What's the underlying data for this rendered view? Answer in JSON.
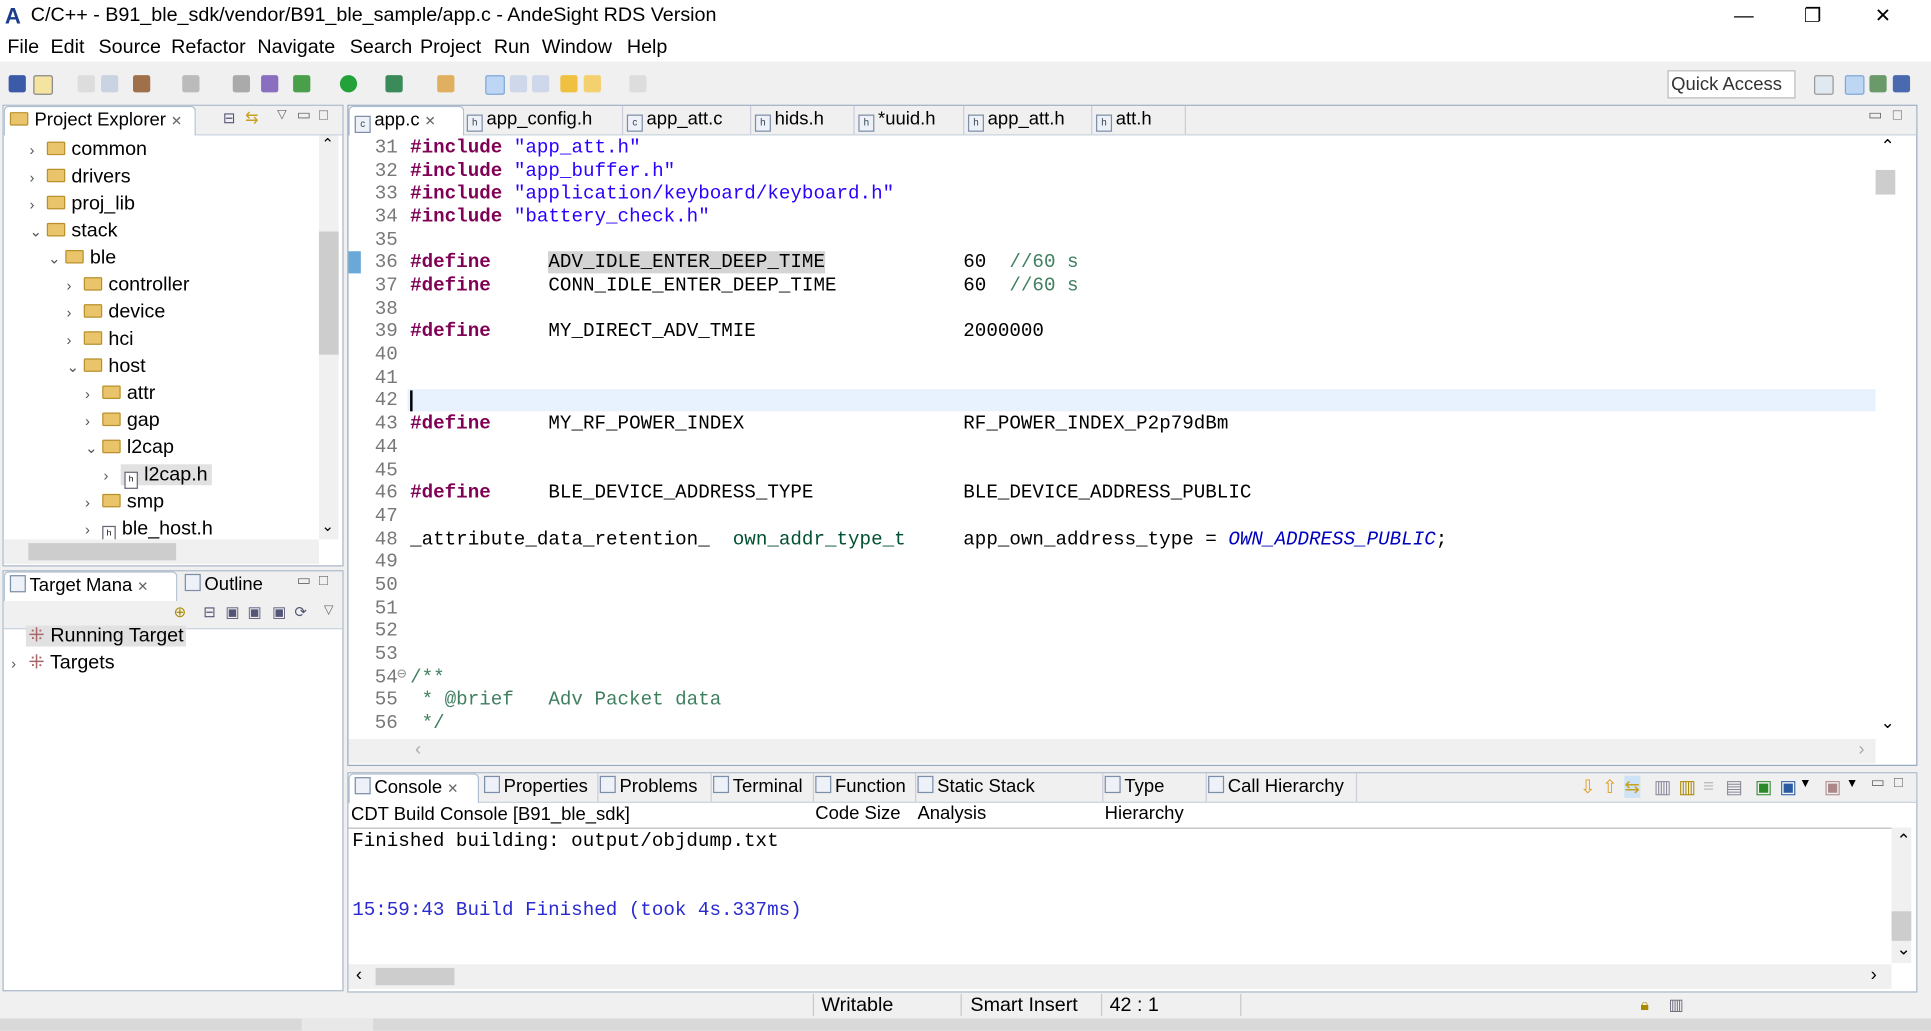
{
  "window": {
    "title": "C/C++ - B91_ble_sdk/vendor/B91_ble_sample/app.c - AndeSight RDS Version",
    "minimize": "—",
    "restore": "❐",
    "close": "✕"
  },
  "menu": [
    "File",
    "Edit",
    "Source",
    "Refactor",
    "Navigate",
    "Search",
    "Project",
    "Run",
    "Window",
    "Help"
  ],
  "toolbar": {
    "quick_access": "Quick Access"
  },
  "project_explorer": {
    "title": "Project Explorer",
    "items": [
      {
        "label": "common",
        "depth": 1,
        "state": "collapsed",
        "kind": "folder"
      },
      {
        "label": "drivers",
        "depth": 1,
        "state": "collapsed",
        "kind": "folder"
      },
      {
        "label": "proj_lib",
        "depth": 1,
        "state": "collapsed",
        "kind": "folder"
      },
      {
        "label": "stack",
        "depth": 1,
        "state": "expanded",
        "kind": "folder"
      },
      {
        "label": "ble",
        "depth": 2,
        "state": "expanded",
        "kind": "folder"
      },
      {
        "label": "controller",
        "depth": 3,
        "state": "collapsed",
        "kind": "folder"
      },
      {
        "label": "device",
        "depth": 3,
        "state": "collapsed",
        "kind": "folder"
      },
      {
        "label": "hci",
        "depth": 3,
        "state": "collapsed",
        "kind": "folder"
      },
      {
        "label": "host",
        "depth": 3,
        "state": "expanded",
        "kind": "folder"
      },
      {
        "label": "attr",
        "depth": 4,
        "state": "collapsed",
        "kind": "folder"
      },
      {
        "label": "gap",
        "depth": 4,
        "state": "collapsed",
        "kind": "folder"
      },
      {
        "label": "l2cap",
        "depth": 4,
        "state": "expanded",
        "kind": "folder"
      },
      {
        "label": "l2cap.h",
        "depth": 5,
        "state": "collapsed",
        "kind": "file",
        "selected": true
      },
      {
        "label": "smp",
        "depth": 4,
        "state": "collapsed",
        "kind": "folder"
      },
      {
        "label": "ble_host.h",
        "depth": 4,
        "state": "collapsed",
        "kind": "file"
      }
    ]
  },
  "target_manager": {
    "tabs": [
      "Target Mana",
      "Outline"
    ],
    "items": [
      {
        "label": "Running Target",
        "selected": true
      },
      {
        "label": "Targets"
      }
    ]
  },
  "editor": {
    "tabs": [
      {
        "label": "app.c",
        "active": true
      },
      {
        "label": "app_config.h"
      },
      {
        "label": "app_att.c"
      },
      {
        "label": "hids.h"
      },
      {
        "label": "*uuid.h"
      },
      {
        "label": "app_att.h"
      },
      {
        "label": "att.h"
      }
    ],
    "lines": [
      {
        "n": "31",
        "tokens": [
          [
            "kw",
            "#include"
          ],
          [
            "",
            " "
          ],
          [
            "str",
            "\"app_att.h\""
          ]
        ]
      },
      {
        "n": "32",
        "tokens": [
          [
            "kw",
            "#include"
          ],
          [
            "",
            " "
          ],
          [
            "str",
            "\"app_buffer.h\""
          ]
        ]
      },
      {
        "n": "33",
        "tokens": [
          [
            "kw",
            "#include"
          ],
          [
            "",
            " "
          ],
          [
            "str",
            "\"application/keyboard/keyboard.h\""
          ]
        ]
      },
      {
        "n": "34",
        "tokens": [
          [
            "kw",
            "#include"
          ],
          [
            "",
            " "
          ],
          [
            "str",
            "\"battery_check.h\""
          ]
        ]
      },
      {
        "n": "35",
        "tokens": []
      },
      {
        "n": "36",
        "tokens": [
          [
            "kw",
            "#define"
          ],
          [
            "",
            "     "
          ],
          [
            "hl",
            "ADV_IDLE_ENTER_DEEP_TIME"
          ],
          [
            "",
            "            60  "
          ],
          [
            "cm",
            "//60 s"
          ]
        ]
      },
      {
        "n": "37",
        "tokens": [
          [
            "kw",
            "#define"
          ],
          [
            "",
            "     "
          ],
          [
            "",
            "CONN_IDLE_ENTER_DEEP_TIME"
          ],
          [
            "",
            "           60  "
          ],
          [
            "cm",
            "//60 s"
          ]
        ]
      },
      {
        "n": "38",
        "tokens": []
      },
      {
        "n": "39",
        "tokens": [
          [
            "kw",
            "#define"
          ],
          [
            "",
            "     "
          ],
          [
            "",
            "MY_DIRECT_ADV_TMIE"
          ],
          [
            "",
            "                  2000000"
          ]
        ]
      },
      {
        "n": "40",
        "tokens": []
      },
      {
        "n": "41",
        "tokens": []
      },
      {
        "n": "42",
        "tokens": [],
        "current": true
      },
      {
        "n": "43",
        "tokens": [
          [
            "kw",
            "#define"
          ],
          [
            "",
            "     "
          ],
          [
            "",
            "MY_RF_POWER_INDEX"
          ],
          [
            "",
            "                   RF_POWER_INDEX_P2p79dBm"
          ]
        ]
      },
      {
        "n": "44",
        "tokens": []
      },
      {
        "n": "45",
        "tokens": []
      },
      {
        "n": "46",
        "tokens": [
          [
            "kw",
            "#define"
          ],
          [
            "",
            "     "
          ],
          [
            "",
            "BLE_DEVICE_ADDRESS_TYPE"
          ],
          [
            "",
            "             BLE_DEVICE_ADDRESS_PUBLIC"
          ]
        ]
      },
      {
        "n": "47",
        "tokens": []
      },
      {
        "n": "48",
        "tokens": [
          [
            "",
            "_attribute_data_retention_  "
          ],
          [
            "typ",
            "own_addr_type_t"
          ],
          [
            "",
            "     app_own_address_type = "
          ],
          [
            "en",
            "OWN_ADDRESS_PUBLIC"
          ],
          [
            "",
            ";"
          ]
        ]
      },
      {
        "n": "49",
        "tokens": []
      },
      {
        "n": "50",
        "tokens": []
      },
      {
        "n": "51",
        "tokens": []
      },
      {
        "n": "52",
        "tokens": []
      },
      {
        "n": "53",
        "tokens": []
      },
      {
        "n": "54",
        "tokens": [
          [
            "cm",
            "/**"
          ]
        ],
        "fold": true
      },
      {
        "n": "55",
        "tokens": [
          [
            "cm",
            " * @brief   Adv Packet data"
          ]
        ]
      },
      {
        "n": "56",
        "tokens": [
          [
            "cm",
            " */"
          ]
        ]
      }
    ]
  },
  "console": {
    "tabs": [
      "Console",
      "Properties",
      "Problems",
      "Terminal",
      "Function Code Size",
      "Static Stack Analysis",
      "Type Hierarchy",
      "Call Hierarchy"
    ],
    "header": "CDT Build Console [B91_ble_sdk]",
    "lines": [
      {
        "text": "Finished building: output/objdump.txt",
        "color": "#000000"
      },
      {
        "text": "",
        "color": "#000000"
      },
      {
        "text": "",
        "color": "#000000"
      },
      {
        "text": "15:59:43 Build Finished (took 4s.337ms)",
        "color": "#2a2ad0"
      }
    ]
  },
  "status": {
    "writable": "Writable",
    "insert_mode": "Smart Insert",
    "position": "42 : 1"
  }
}
